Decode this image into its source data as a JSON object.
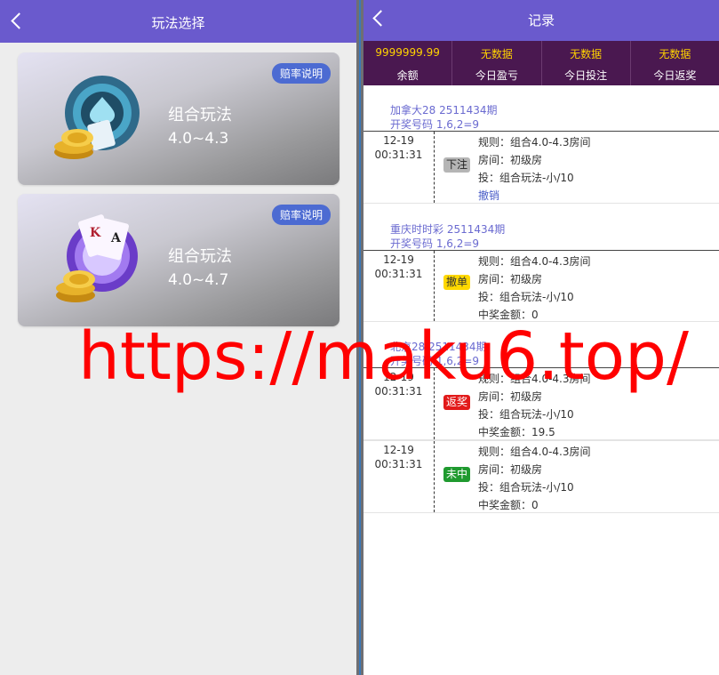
{
  "left": {
    "header_title": "玩法选择",
    "cards": [
      {
        "name": "组合玩法",
        "range": "4.0~4.3",
        "odds_label": "赔率说明"
      },
      {
        "name": "组合玩法",
        "range": "4.0~4.7",
        "odds_label": "赔率说明"
      }
    ]
  },
  "right": {
    "header_title": "记录",
    "stats": [
      {
        "value": "9999999.99",
        "label": "余额"
      },
      {
        "value": "无数据",
        "label": "今日盈亏"
      },
      {
        "value": "无数据",
        "label": "今日投注"
      },
      {
        "value": "无数据",
        "label": "今日返奖"
      }
    ],
    "groups": [
      {
        "title": "加拿大28  2511434期",
        "result": "开奖号码  1,6,2=9"
      },
      {
        "title": "重庆时时彩  2511434期",
        "result": "开奖号码  1,6,2=9"
      },
      {
        "title": "北京28  2511434期",
        "result": "开奖号码  1,6,2=9"
      }
    ],
    "records": [
      {
        "date": "12-19",
        "time": "00:31:31",
        "badge": "下注",
        "rule": "规则：组合4.0-4.3房间",
        "room": "房间：初级房",
        "bet": "投：组合玩法-小/10",
        "extra": "撤销"
      },
      {
        "date": "12-19",
        "time": "00:31:31",
        "badge": "撤单",
        "rule": "规则：组合4.0-4.3房间",
        "room": "房间：初级房",
        "bet": "投：组合玩法-小/10",
        "extra": "中奖金额：0"
      },
      {
        "date": "12-19",
        "time": "00:31:31",
        "badge": "返奖",
        "rule": "规则：组合4.0-4.3房间",
        "room": "房间：初级房",
        "bet": "投：组合玩法-小/10",
        "extra": "中奖金额：19.5"
      },
      {
        "date": "12-19",
        "time": "00:31:31",
        "badge": "未中",
        "rule": "规则：组合4.0-4.3房间",
        "room": "房间：初级房",
        "bet": "投：组合玩法-小/10",
        "extra": "中奖金额：0"
      }
    ]
  },
  "watermark": "https://maku6.top/",
  "colors": {
    "header": "#6a5acd",
    "stats_bg": "#4a1850",
    "stats_value": "#ffd200",
    "badge_bet": "#b5b5b5",
    "badge_cancel": "#ffd800",
    "badge_return": "#e21a1a",
    "badge_miss": "#1f9a2f"
  }
}
